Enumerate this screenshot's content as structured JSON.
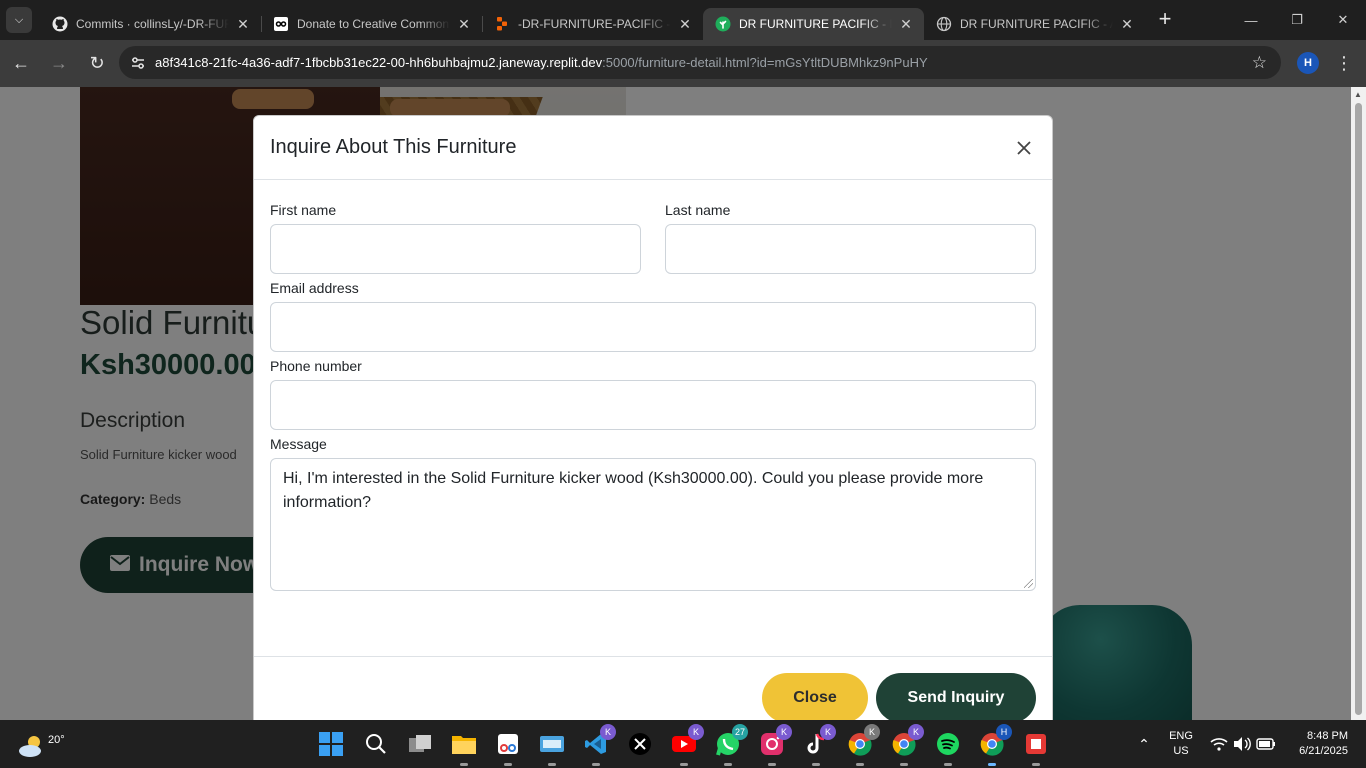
{
  "browser": {
    "tabs": [
      {
        "title": "Commits · collinsLy/-DR-FURNITURE-PACIFIC",
        "icon": "github-icon",
        "active": false
      },
      {
        "title": "Donate to Creative Commons",
        "icon": "creative-commons-icon",
        "active": false
      },
      {
        "title": "-DR-FURNITURE-PACIFIC - Replit",
        "icon": "replit-icon",
        "active": false
      },
      {
        "title": "DR FURNITURE PACIFIC - Furniture",
        "icon": "replit-leaf-icon",
        "active": true
      },
      {
        "title": "DR FURNITURE PACIFIC - Admin",
        "icon": "globe-icon",
        "active": false
      }
    ],
    "url_host": "a8f341c8-21fc-4a36-adf7-1fbcbb31ec22-00-hh6buhbajmu2.janeway.replit.dev",
    "url_path": ":5000/furniture-detail.html?id=mGsYtltDUBMhkz9nPuHY",
    "profile_initial": "H"
  },
  "page": {
    "title": "Solid Furniture kicker wood",
    "price": "Ksh30000.00",
    "description_heading": "Description",
    "description": "Solid Furniture kicker wood",
    "category_label": "Category:",
    "category_value": "Beds",
    "inquire_button": "Inquire Now"
  },
  "modal": {
    "title": "Inquire About This Furniture",
    "first_name_label": "First name",
    "last_name_label": "Last name",
    "email_label": "Email address",
    "phone_label": "Phone number",
    "message_label": "Message",
    "message_value": "Hi, I'm interested in the Solid Furniture kicker wood (Ksh30000.00). Could you please provide more information?",
    "first_name_value": "",
    "last_name_value": "",
    "email_value": "",
    "phone_value": "",
    "close_button": "Close",
    "send_button": "Send Inquiry"
  },
  "colors": {
    "primary_green": "#1f4236",
    "accent_yellow": "#f0c336"
  },
  "taskbar": {
    "weather_temp": "20°",
    "apps": [
      {
        "name": "start-icon",
        "badge": ""
      },
      {
        "name": "search-icon",
        "badge": ""
      },
      {
        "name": "task-view-icon",
        "badge": ""
      },
      {
        "name": "file-explorer-icon",
        "badge": ""
      },
      {
        "name": "snipping-tool-icon",
        "badge": ""
      },
      {
        "name": "keyboard-app-icon",
        "badge": ""
      },
      {
        "name": "vscode-icon",
        "badge": "K"
      },
      {
        "name": "x-twitter-icon",
        "badge": ""
      },
      {
        "name": "youtube-icon",
        "badge": "K"
      },
      {
        "name": "whatsapp-icon",
        "badge": "27"
      },
      {
        "name": "instagram-icon",
        "badge": "K"
      },
      {
        "name": "tiktok-icon",
        "badge": "K"
      },
      {
        "name": "chrome-icon",
        "badge": "K"
      },
      {
        "name": "chrome-icon",
        "badge": "K"
      },
      {
        "name": "spotify-icon",
        "badge": ""
      },
      {
        "name": "chrome-icon",
        "badge": "H"
      },
      {
        "name": "app-red-icon",
        "badge": ""
      }
    ],
    "lang_primary": "ENG",
    "lang_secondary": "US",
    "time": "8:48 PM",
    "date": "6/21/2025"
  }
}
